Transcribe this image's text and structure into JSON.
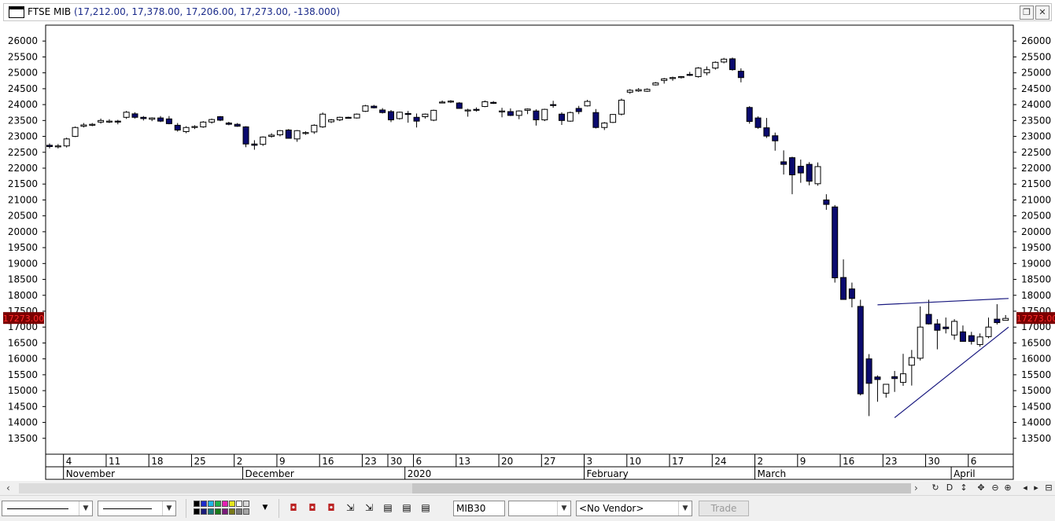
{
  "window": {
    "symbol": "FTSE MIB",
    "quote": "(17,212.00, 17,378.00, 17,206.00, 17,273.00, -138.000)",
    "restore_glyph": "❐",
    "close_glyph": "✕"
  },
  "colors": {
    "up_fill": "#ffffff",
    "down_fill": "#0a0a6e",
    "grid": "#bdbdbd",
    "trendline": "#1a1a80",
    "price_tag_bg": "#7a0000",
    "price_tag_text": "#ff2a2a"
  },
  "chart_data": {
    "type": "candlestick",
    "title": "FTSE MIB",
    "ylim": [
      13000,
      26500
    ],
    "yticks": [
      13500,
      14000,
      14500,
      15000,
      15500,
      16000,
      16500,
      17000,
      17500,
      18000,
      18500,
      19000,
      19500,
      20000,
      20500,
      21000,
      21500,
      22000,
      22500,
      23000,
      23500,
      24000,
      24500,
      25000,
      25500,
      26000
    ],
    "last_price_label": "17273.00",
    "last_price": 17273,
    "day_ticks": [
      "4",
      "11",
      "18",
      "25",
      "2",
      "9",
      "16",
      "23",
      "30",
      "6",
      "13",
      "20",
      "27",
      "3",
      "10",
      "17",
      "24",
      "2",
      "9",
      "16",
      "23",
      "30",
      "6"
    ],
    "month_labels": [
      "November",
      "December",
      "2020",
      "February",
      "March",
      "April"
    ],
    "candles": [
      [
        22720,
        22780,
        22620,
        22680
      ],
      [
        22680,
        22760,
        22620,
        22700
      ],
      [
        22700,
        22960,
        22650,
        22920
      ],
      [
        23000,
        23310,
        22980,
        23280
      ],
      [
        23320,
        23420,
        23280,
        23360
      ],
      [
        23360,
        23420,
        23320,
        23380
      ],
      [
        23450,
        23560,
        23400,
        23500
      ],
      [
        23480,
        23540,
        23420,
        23480
      ],
      [
        23480,
        23520,
        23380,
        23460
      ],
      [
        23600,
        23800,
        23550,
        23760
      ],
      [
        23710,
        23760,
        23560,
        23600
      ],
      [
        23600,
        23640,
        23500,
        23560
      ],
      [
        23540,
        23600,
        23480,
        23580
      ],
      [
        23580,
        23640,
        23450,
        23480
      ],
      [
        23550,
        23640,
        23380,
        23400
      ],
      [
        23350,
        23420,
        23150,
        23200
      ],
      [
        23150,
        23320,
        23100,
        23280
      ],
      [
        23290,
        23350,
        23230,
        23310
      ],
      [
        23300,
        23480,
        23270,
        23450
      ],
      [
        23450,
        23560,
        23400,
        23530
      ],
      [
        23620,
        23640,
        23480,
        23510
      ],
      [
        23420,
        23460,
        23350,
        23380
      ],
      [
        23380,
        23420,
        23300,
        23320
      ],
      [
        23300,
        23320,
        22660,
        22760
      ],
      [
        22760,
        22880,
        22580,
        22720
      ],
      [
        22750,
        23000,
        22700,
        22980
      ],
      [
        23000,
        23100,
        22960,
        23040
      ],
      [
        23050,
        23200,
        23000,
        23180
      ],
      [
        23200,
        23230,
        22930,
        22940
      ],
      [
        22920,
        23200,
        22830,
        23180
      ],
      [
        23100,
        23160,
        23050,
        23120
      ],
      [
        23140,
        23380,
        23080,
        23350
      ],
      [
        23300,
        23750,
        23270,
        23700
      ],
      [
        23460,
        23550,
        23420,
        23520
      ],
      [
        23520,
        23620,
        23480,
        23600
      ],
      [
        23600,
        23620,
        23560,
        23580
      ],
      [
        23580,
        23720,
        23560,
        23700
      ],
      [
        23790,
        23990,
        23770,
        23960
      ],
      [
        23950,
        23990,
        23880,
        23900
      ],
      [
        23830,
        23890,
        23720,
        23750
      ],
      [
        23780,
        23830,
        23450,
        23520
      ],
      [
        23560,
        23780,
        23530,
        23760
      ],
      [
        23720,
        23800,
        23430,
        23700
      ],
      [
        23600,
        23720,
        23280,
        23480
      ],
      [
        23620,
        23720,
        23560,
        23700
      ],
      [
        23510,
        23840,
        23480,
        23820
      ],
      [
        24060,
        24130,
        24040,
        24080
      ],
      [
        24080,
        24140,
        24050,
        24110
      ],
      [
        24050,
        24080,
        23870,
        23880
      ],
      [
        23820,
        23870,
        23620,
        23830
      ],
      [
        23850,
        23910,
        23780,
        23840
      ],
      [
        23940,
        24130,
        23920,
        24090
      ],
      [
        24070,
        24110,
        24020,
        24050
      ],
      [
        23800,
        23900,
        23600,
        23800
      ],
      [
        23780,
        23880,
        23640,
        23660
      ],
      [
        23660,
        23820,
        23540,
        23800
      ],
      [
        23820,
        23880,
        23700,
        23860
      ],
      [
        23800,
        23850,
        23340,
        23520
      ],
      [
        23520,
        23870,
        23480,
        23850
      ],
      [
        24000,
        24120,
        23900,
        23980
      ],
      [
        23700,
        23760,
        23360,
        23500
      ],
      [
        23480,
        23780,
        23460,
        23750
      ],
      [
        23880,
        23960,
        23700,
        23780
      ],
      [
        23960,
        24150,
        23940,
        24100
      ],
      [
        23750,
        23860,
        23250,
        23280
      ],
      [
        23280,
        23450,
        23200,
        23420
      ],
      [
        23440,
        23700,
        23420,
        23690
      ],
      [
        23700,
        24190,
        23660,
        24140
      ],
      [
        24390,
        24490,
        24340,
        24450
      ],
      [
        24430,
        24520,
        24400,
        24470
      ],
      [
        24420,
        24510,
        24400,
        24480
      ],
      [
        24620,
        24710,
        24600,
        24680
      ],
      [
        24760,
        24840,
        24660,
        24810
      ],
      [
        24820,
        24880,
        24750,
        24850
      ],
      [
        24850,
        24900,
        24820,
        24880
      ],
      [
        24950,
        25030,
        24900,
        24920
      ],
      [
        24880,
        25180,
        24850,
        25150
      ],
      [
        25000,
        25200,
        24920,
        25100
      ],
      [
        25150,
        25360,
        25100,
        25330
      ],
      [
        25340,
        25470,
        25300,
        25430
      ],
      [
        25440,
        25480,
        25070,
        25100
      ],
      [
        25050,
        25140,
        24700,
        24850
      ],
      [
        23910,
        23950,
        23400,
        23470
      ],
      [
        23580,
        23630,
        23240,
        23280
      ],
      [
        23270,
        23580,
        22950,
        23010
      ],
      [
        23020,
        23120,
        22550,
        22860
      ],
      [
        22200,
        22560,
        21800,
        22120
      ],
      [
        22330,
        22360,
        21180,
        21790
      ],
      [
        22060,
        22270,
        21540,
        21850
      ],
      [
        22120,
        22190,
        21460,
        21590
      ],
      [
        21510,
        22180,
        21450,
        22050
      ],
      [
        21000,
        21180,
        20690,
        20860
      ],
      [
        20780,
        20840,
        18400,
        18550
      ],
      [
        18560,
        19130,
        17870,
        17870
      ],
      [
        18200,
        18400,
        17620,
        17900
      ],
      [
        17650,
        17860,
        14850,
        14900
      ],
      [
        16000,
        16150,
        14200,
        15230
      ],
      [
        15430,
        15480,
        14650,
        15350
      ],
      [
        14920,
        15160,
        14780,
        15200
      ],
      [
        15440,
        15620,
        14960,
        15380
      ],
      [
        15260,
        16160,
        15150,
        15530
      ],
      [
        15800,
        16280,
        15160,
        16040
      ],
      [
        16020,
        17650,
        15950,
        17000
      ],
      [
        17400,
        17860,
        17080,
        17100
      ],
      [
        17100,
        17250,
        16300,
        16900
      ],
      [
        17000,
        17300,
        16800,
        16950
      ],
      [
        16750,
        17250,
        16600,
        17180
      ],
      [
        16850,
        17050,
        16550,
        16550
      ],
      [
        16730,
        16850,
        16450,
        16550
      ],
      [
        16450,
        16800,
        16380,
        16690
      ],
      [
        16700,
        17300,
        16650,
        17000
      ],
      [
        17250,
        17720,
        17080,
        17140
      ],
      [
        17212,
        17378,
        17206,
        17273
      ]
    ],
    "trendlines": [
      {
        "from": [
          97,
          17700
        ],
        "to": [
          119,
          17900
        ]
      },
      {
        "from": [
          99,
          14150
        ],
        "to": [
          119,
          17000
        ]
      }
    ]
  },
  "toolbar": {
    "line_style_options": [
      "solid",
      "solid"
    ],
    "symbol_value": "MIB30",
    "empty_combo": "",
    "vendor_value": "<No Vendor>",
    "trade_label": "Trade",
    "palette": [
      "#000000",
      "#1e2ccc",
      "#1fb6e6",
      "#1fb34a",
      "#e61fb3",
      "#e6e61f",
      "#ffffff",
      "#d9d9d9",
      "#000000",
      "#1a1a7a",
      "#1a7a7a",
      "#1a7a1a",
      "#7a1a7a",
      "#7a7a1a",
      "#7a7a7a",
      "#a6a6a6"
    ],
    "nav_icons": [
      "↻",
      "D",
      "↕",
      "✥",
      "⊖",
      "⊕",
      "◂",
      "▸",
      "⊟"
    ]
  }
}
